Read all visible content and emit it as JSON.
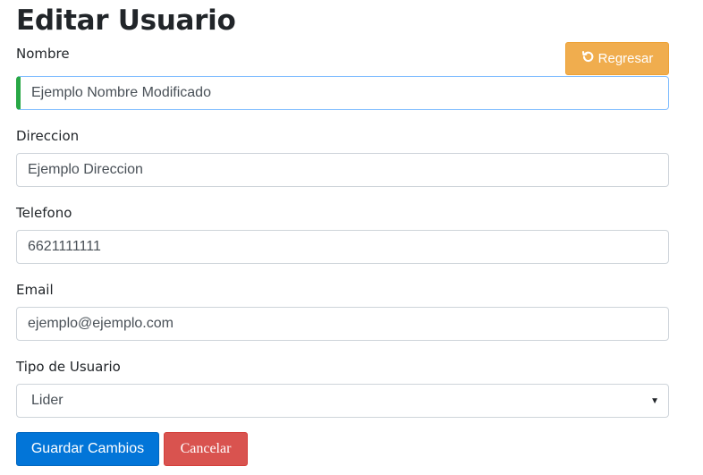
{
  "page": {
    "title": "Editar Usuario"
  },
  "back_button": {
    "label": "Regresar",
    "icon": "undo-icon",
    "color": "#f0ad4e"
  },
  "form": {
    "nombre": {
      "label": "Nombre",
      "value": "Ejemplo Nombre Modificado"
    },
    "direccion": {
      "label": "Direccion",
      "value": "Ejemplo Direccion"
    },
    "telefono": {
      "label": "Telefono",
      "value": "6621111111"
    },
    "email": {
      "label": "Email",
      "value": "ejemplo@ejemplo.com"
    },
    "tipo_usuario": {
      "label": "Tipo de Usuario",
      "selected": "Lider"
    }
  },
  "actions": {
    "save_label": "Guardar Cambios",
    "cancel_label": "Cancelar",
    "save_color": "#0275d8",
    "cancel_color": "#d9534f"
  }
}
